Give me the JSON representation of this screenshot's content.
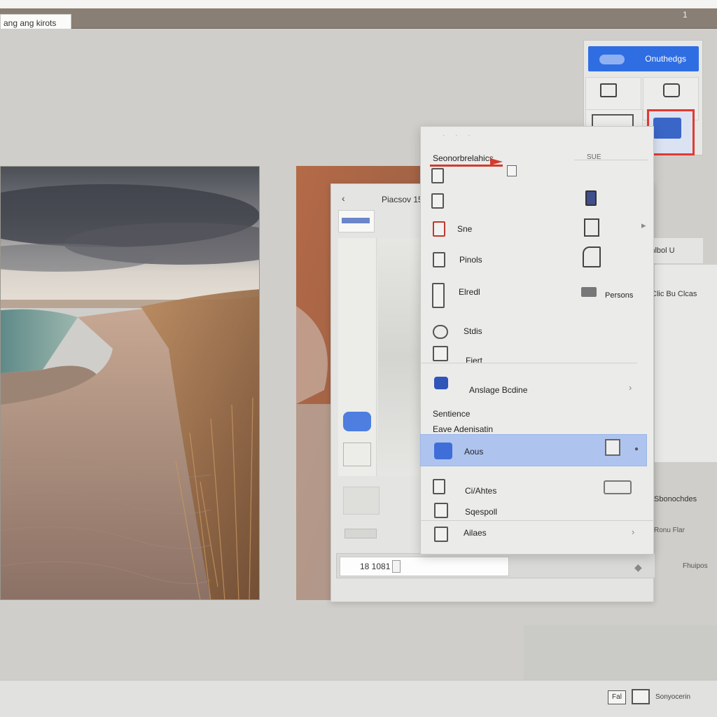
{
  "window": {
    "tab_label": "ang ang kirots",
    "indicator": "1"
  },
  "top_right_card": {
    "button_label": "Onuthedgs"
  },
  "back_panel": {
    "title": "Piacsov 15",
    "back_label": "‹",
    "right_items": [
      "Enlbol  U",
      "Clic Bu Clcas",
      "Sbonochdes",
      "Ronu Flar",
      "Fhuipos"
    ]
  },
  "menu": {
    "header_label": "Seonorbrelahics",
    "header_right": "SUE",
    "items": [
      {
        "label": "",
        "right_label": ""
      },
      {
        "label": "Sne",
        "right_label": ""
      },
      {
        "label": "Pinols",
        "right_label": ""
      },
      {
        "label": "Elredl",
        "right_label": "Persons"
      },
      {
        "label": "Stdis",
        "right_label": ""
      },
      {
        "label": "Fiert",
        "right_label": ""
      },
      {
        "label": "Anslage Bcdine",
        "right_label": ""
      }
    ],
    "section_label": "Sentience",
    "section_sub": "Eave Adenisatin",
    "highlight_label": "Aous",
    "items_after": [
      {
        "label": "Ci/Ahtes"
      },
      {
        "label": "Sqespoll"
      },
      {
        "label": "Ailaes"
      }
    ]
  },
  "search": {
    "value": "18 1081"
  },
  "status_bar": {
    "button1_label": "Fal",
    "label": "Sonyocerin"
  }
}
